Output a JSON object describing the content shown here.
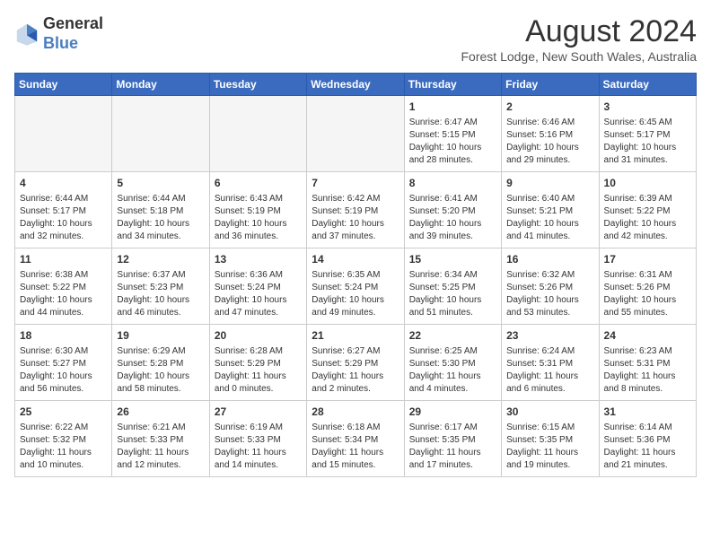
{
  "header": {
    "logo_general": "General",
    "logo_blue": "Blue",
    "month_year": "August 2024",
    "location": "Forest Lodge, New South Wales, Australia"
  },
  "days_of_week": [
    "Sunday",
    "Monday",
    "Tuesday",
    "Wednesday",
    "Thursday",
    "Friday",
    "Saturday"
  ],
  "weeks": [
    [
      {
        "day": "",
        "empty": true
      },
      {
        "day": "",
        "empty": true
      },
      {
        "day": "",
        "empty": true
      },
      {
        "day": "",
        "empty": true
      },
      {
        "day": "1",
        "sunrise": "6:47 AM",
        "sunset": "5:15 PM",
        "daylight": "10 hours and 28 minutes."
      },
      {
        "day": "2",
        "sunrise": "6:46 AM",
        "sunset": "5:16 PM",
        "daylight": "10 hours and 29 minutes."
      },
      {
        "day": "3",
        "sunrise": "6:45 AM",
        "sunset": "5:17 PM",
        "daylight": "10 hours and 31 minutes."
      }
    ],
    [
      {
        "day": "4",
        "sunrise": "6:44 AM",
        "sunset": "5:17 PM",
        "daylight": "10 hours and 32 minutes."
      },
      {
        "day": "5",
        "sunrise": "6:44 AM",
        "sunset": "5:18 PM",
        "daylight": "10 hours and 34 minutes."
      },
      {
        "day": "6",
        "sunrise": "6:43 AM",
        "sunset": "5:19 PM",
        "daylight": "10 hours and 36 minutes."
      },
      {
        "day": "7",
        "sunrise": "6:42 AM",
        "sunset": "5:19 PM",
        "daylight": "10 hours and 37 minutes."
      },
      {
        "day": "8",
        "sunrise": "6:41 AM",
        "sunset": "5:20 PM",
        "daylight": "10 hours and 39 minutes."
      },
      {
        "day": "9",
        "sunrise": "6:40 AM",
        "sunset": "5:21 PM",
        "daylight": "10 hours and 41 minutes."
      },
      {
        "day": "10",
        "sunrise": "6:39 AM",
        "sunset": "5:22 PM",
        "daylight": "10 hours and 42 minutes."
      }
    ],
    [
      {
        "day": "11",
        "sunrise": "6:38 AM",
        "sunset": "5:22 PM",
        "daylight": "10 hours and 44 minutes."
      },
      {
        "day": "12",
        "sunrise": "6:37 AM",
        "sunset": "5:23 PM",
        "daylight": "10 hours and 46 minutes."
      },
      {
        "day": "13",
        "sunrise": "6:36 AM",
        "sunset": "5:24 PM",
        "daylight": "10 hours and 47 minutes."
      },
      {
        "day": "14",
        "sunrise": "6:35 AM",
        "sunset": "5:24 PM",
        "daylight": "10 hours and 49 minutes."
      },
      {
        "day": "15",
        "sunrise": "6:34 AM",
        "sunset": "5:25 PM",
        "daylight": "10 hours and 51 minutes."
      },
      {
        "day": "16",
        "sunrise": "6:32 AM",
        "sunset": "5:26 PM",
        "daylight": "10 hours and 53 minutes."
      },
      {
        "day": "17",
        "sunrise": "6:31 AM",
        "sunset": "5:26 PM",
        "daylight": "10 hours and 55 minutes."
      }
    ],
    [
      {
        "day": "18",
        "sunrise": "6:30 AM",
        "sunset": "5:27 PM",
        "daylight": "10 hours and 56 minutes."
      },
      {
        "day": "19",
        "sunrise": "6:29 AM",
        "sunset": "5:28 PM",
        "daylight": "10 hours and 58 minutes."
      },
      {
        "day": "20",
        "sunrise": "6:28 AM",
        "sunset": "5:29 PM",
        "daylight": "11 hours and 0 minutes."
      },
      {
        "day": "21",
        "sunrise": "6:27 AM",
        "sunset": "5:29 PM",
        "daylight": "11 hours and 2 minutes."
      },
      {
        "day": "22",
        "sunrise": "6:25 AM",
        "sunset": "5:30 PM",
        "daylight": "11 hours and 4 minutes."
      },
      {
        "day": "23",
        "sunrise": "6:24 AM",
        "sunset": "5:31 PM",
        "daylight": "11 hours and 6 minutes."
      },
      {
        "day": "24",
        "sunrise": "6:23 AM",
        "sunset": "5:31 PM",
        "daylight": "11 hours and 8 minutes."
      }
    ],
    [
      {
        "day": "25",
        "sunrise": "6:22 AM",
        "sunset": "5:32 PM",
        "daylight": "11 hours and 10 minutes."
      },
      {
        "day": "26",
        "sunrise": "6:21 AM",
        "sunset": "5:33 PM",
        "daylight": "11 hours and 12 minutes."
      },
      {
        "day": "27",
        "sunrise": "6:19 AM",
        "sunset": "5:33 PM",
        "daylight": "11 hours and 14 minutes."
      },
      {
        "day": "28",
        "sunrise": "6:18 AM",
        "sunset": "5:34 PM",
        "daylight": "11 hours and 15 minutes."
      },
      {
        "day": "29",
        "sunrise": "6:17 AM",
        "sunset": "5:35 PM",
        "daylight": "11 hours and 17 minutes."
      },
      {
        "day": "30",
        "sunrise": "6:15 AM",
        "sunset": "5:35 PM",
        "daylight": "11 hours and 19 minutes."
      },
      {
        "day": "31",
        "sunrise": "6:14 AM",
        "sunset": "5:36 PM",
        "daylight": "11 hours and 21 minutes."
      }
    ]
  ]
}
